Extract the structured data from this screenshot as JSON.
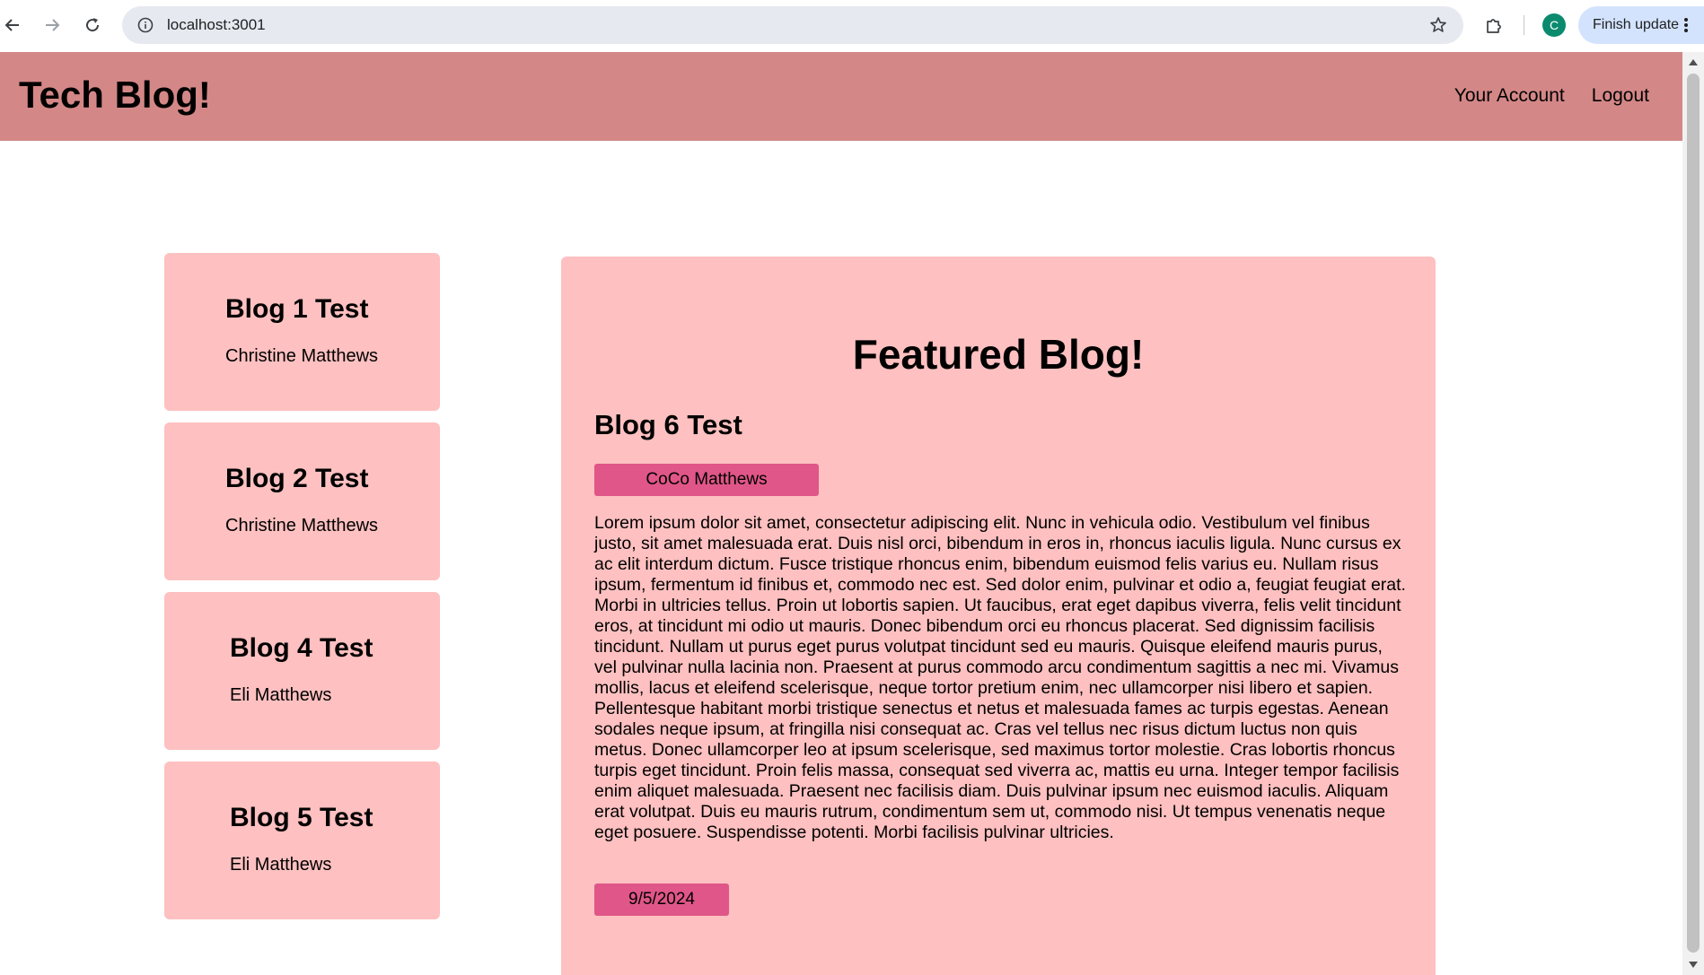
{
  "browser": {
    "url": "localhost:3001",
    "profile_initial": "C",
    "finish_update_label": "Finish update"
  },
  "header": {
    "title": "Tech Blog!",
    "nav": [
      "Your Account",
      "Logout"
    ],
    "background": "#d48787"
  },
  "sidebar": {
    "posts": [
      {
        "title": "Blog 1 Test",
        "author": "Christine Matthews"
      },
      {
        "title": "Blog 2 Test",
        "author": "Christine Matthews"
      },
      {
        "title": "Blog 4 Test",
        "author": "Eli Matthews"
      },
      {
        "title": "Blog 5 Test",
        "author": "Eli Matthews"
      }
    ],
    "card_color": "#fec0c0"
  },
  "featured": {
    "heading": "Featured Blog!",
    "title": "Blog 6 Test",
    "author": "CoCo Matthews",
    "body": "Lorem ipsum dolor sit amet, consectetur adipiscing elit. Nunc in vehicula odio. Vestibulum vel finibus justo, sit amet malesuada erat. Duis nisl orci, bibendum in eros in, rhoncus iaculis ligula. Nunc cursus ex ac elit interdum dictum. Fusce tristique rhoncus enim, bibendum euismod felis varius eu. Nullam risus ipsum, fermentum id finibus et, commodo nec est. Sed dolor enim, pulvinar et odio a, feugiat feugiat erat. Morbi in ultricies tellus. Proin ut lobortis sapien. Ut faucibus, erat eget dapibus viverra, felis velit tincidunt eros, at tincidunt mi odio ut mauris. Donec bibendum orci eu rhoncus placerat. Sed dignissim facilisis tincidunt. Nullam ut purus eget purus volutpat tincidunt sed eu mauris. Quisque eleifend mauris purus, vel pulvinar nulla lacinia non. Praesent at purus commodo arcu condimentum sagittis a nec mi. Vivamus mollis, lacus et eleifend scelerisque, neque tortor pretium enim, nec ullamcorper nisi libero et sapien. Pellentesque habitant morbi tristique senectus et netus et malesuada fames ac turpis egestas. Aenean sodales neque ipsum, at fringilla nisi consequat ac. Cras vel tellus nec risus dictum luctus non quis metus. Donec ullamcorper leo at ipsum scelerisque, sed maximus tortor molestie. Cras lobortis rhoncus turpis eget tincidunt. Proin felis massa, consequat sed viverra ac, mattis eu urna. Integer tempor facilisis enim aliquet malesuada. Praesent nec facilisis diam. Duis pulvinar ipsum nec euismod iaculis. Aliquam erat volutpat. Duis eu mauris rutrum, condimentum sem ut, commodo nisi. Ut tempus venenatis neque eget posuere. Suspendisse potenti. Morbi facilisis pulvinar ultricies.",
    "date": "9/5/2024",
    "badge_color": "#e05688"
  }
}
